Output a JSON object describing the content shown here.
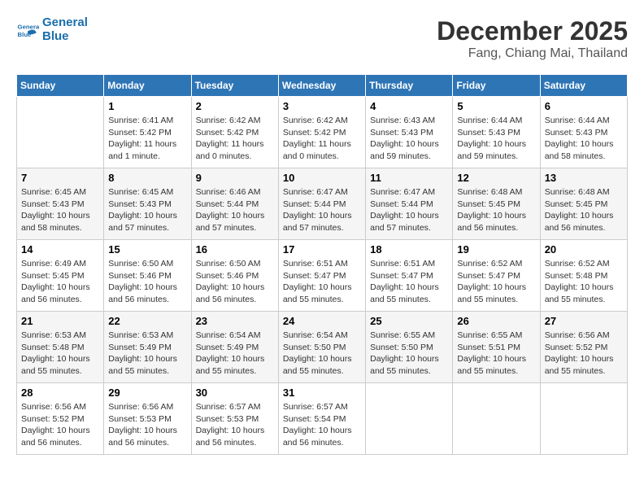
{
  "header": {
    "logo_line1": "General",
    "logo_line2": "Blue",
    "month": "December 2025",
    "location": "Fang, Chiang Mai, Thailand"
  },
  "weekdays": [
    "Sunday",
    "Monday",
    "Tuesday",
    "Wednesday",
    "Thursday",
    "Friday",
    "Saturday"
  ],
  "weeks": [
    [
      {
        "day": "",
        "sunrise": "",
        "sunset": "",
        "daylight": ""
      },
      {
        "day": "1",
        "sunrise": "Sunrise: 6:41 AM",
        "sunset": "Sunset: 5:42 PM",
        "daylight": "Daylight: 11 hours and 1 minute."
      },
      {
        "day": "2",
        "sunrise": "Sunrise: 6:42 AM",
        "sunset": "Sunset: 5:42 PM",
        "daylight": "Daylight: 11 hours and 0 minutes."
      },
      {
        "day": "3",
        "sunrise": "Sunrise: 6:42 AM",
        "sunset": "Sunset: 5:42 PM",
        "daylight": "Daylight: 11 hours and 0 minutes."
      },
      {
        "day": "4",
        "sunrise": "Sunrise: 6:43 AM",
        "sunset": "Sunset: 5:43 PM",
        "daylight": "Daylight: 10 hours and 59 minutes."
      },
      {
        "day": "5",
        "sunrise": "Sunrise: 6:44 AM",
        "sunset": "Sunset: 5:43 PM",
        "daylight": "Daylight: 10 hours and 59 minutes."
      },
      {
        "day": "6",
        "sunrise": "Sunrise: 6:44 AM",
        "sunset": "Sunset: 5:43 PM",
        "daylight": "Daylight: 10 hours and 58 minutes."
      }
    ],
    [
      {
        "day": "7",
        "sunrise": "Sunrise: 6:45 AM",
        "sunset": "Sunset: 5:43 PM",
        "daylight": "Daylight: 10 hours and 58 minutes."
      },
      {
        "day": "8",
        "sunrise": "Sunrise: 6:45 AM",
        "sunset": "Sunset: 5:43 PM",
        "daylight": "Daylight: 10 hours and 57 minutes."
      },
      {
        "day": "9",
        "sunrise": "Sunrise: 6:46 AM",
        "sunset": "Sunset: 5:44 PM",
        "daylight": "Daylight: 10 hours and 57 minutes."
      },
      {
        "day": "10",
        "sunrise": "Sunrise: 6:47 AM",
        "sunset": "Sunset: 5:44 PM",
        "daylight": "Daylight: 10 hours and 57 minutes."
      },
      {
        "day": "11",
        "sunrise": "Sunrise: 6:47 AM",
        "sunset": "Sunset: 5:44 PM",
        "daylight": "Daylight: 10 hours and 57 minutes."
      },
      {
        "day": "12",
        "sunrise": "Sunrise: 6:48 AM",
        "sunset": "Sunset: 5:45 PM",
        "daylight": "Daylight: 10 hours and 56 minutes."
      },
      {
        "day": "13",
        "sunrise": "Sunrise: 6:48 AM",
        "sunset": "Sunset: 5:45 PM",
        "daylight": "Daylight: 10 hours and 56 minutes."
      }
    ],
    [
      {
        "day": "14",
        "sunrise": "Sunrise: 6:49 AM",
        "sunset": "Sunset: 5:45 PM",
        "daylight": "Daylight: 10 hours and 56 minutes."
      },
      {
        "day": "15",
        "sunrise": "Sunrise: 6:50 AM",
        "sunset": "Sunset: 5:46 PM",
        "daylight": "Daylight: 10 hours and 56 minutes."
      },
      {
        "day": "16",
        "sunrise": "Sunrise: 6:50 AM",
        "sunset": "Sunset: 5:46 PM",
        "daylight": "Daylight: 10 hours and 56 minutes."
      },
      {
        "day": "17",
        "sunrise": "Sunrise: 6:51 AM",
        "sunset": "Sunset: 5:47 PM",
        "daylight": "Daylight: 10 hours and 55 minutes."
      },
      {
        "day": "18",
        "sunrise": "Sunrise: 6:51 AM",
        "sunset": "Sunset: 5:47 PM",
        "daylight": "Daylight: 10 hours and 55 minutes."
      },
      {
        "day": "19",
        "sunrise": "Sunrise: 6:52 AM",
        "sunset": "Sunset: 5:47 PM",
        "daylight": "Daylight: 10 hours and 55 minutes."
      },
      {
        "day": "20",
        "sunrise": "Sunrise: 6:52 AM",
        "sunset": "Sunset: 5:48 PM",
        "daylight": "Daylight: 10 hours and 55 minutes."
      }
    ],
    [
      {
        "day": "21",
        "sunrise": "Sunrise: 6:53 AM",
        "sunset": "Sunset: 5:48 PM",
        "daylight": "Daylight: 10 hours and 55 minutes."
      },
      {
        "day": "22",
        "sunrise": "Sunrise: 6:53 AM",
        "sunset": "Sunset: 5:49 PM",
        "daylight": "Daylight: 10 hours and 55 minutes."
      },
      {
        "day": "23",
        "sunrise": "Sunrise: 6:54 AM",
        "sunset": "Sunset: 5:49 PM",
        "daylight": "Daylight: 10 hours and 55 minutes."
      },
      {
        "day": "24",
        "sunrise": "Sunrise: 6:54 AM",
        "sunset": "Sunset: 5:50 PM",
        "daylight": "Daylight: 10 hours and 55 minutes."
      },
      {
        "day": "25",
        "sunrise": "Sunrise: 6:55 AM",
        "sunset": "Sunset: 5:50 PM",
        "daylight": "Daylight: 10 hours and 55 minutes."
      },
      {
        "day": "26",
        "sunrise": "Sunrise: 6:55 AM",
        "sunset": "Sunset: 5:51 PM",
        "daylight": "Daylight: 10 hours and 55 minutes."
      },
      {
        "day": "27",
        "sunrise": "Sunrise: 6:56 AM",
        "sunset": "Sunset: 5:52 PM",
        "daylight": "Daylight: 10 hours and 55 minutes."
      }
    ],
    [
      {
        "day": "28",
        "sunrise": "Sunrise: 6:56 AM",
        "sunset": "Sunset: 5:52 PM",
        "daylight": "Daylight: 10 hours and 56 minutes."
      },
      {
        "day": "29",
        "sunrise": "Sunrise: 6:56 AM",
        "sunset": "Sunset: 5:53 PM",
        "daylight": "Daylight: 10 hours and 56 minutes."
      },
      {
        "day": "30",
        "sunrise": "Sunrise: 6:57 AM",
        "sunset": "Sunset: 5:53 PM",
        "daylight": "Daylight: 10 hours and 56 minutes."
      },
      {
        "day": "31",
        "sunrise": "Sunrise: 6:57 AM",
        "sunset": "Sunset: 5:54 PM",
        "daylight": "Daylight: 10 hours and 56 minutes."
      },
      {
        "day": "",
        "sunrise": "",
        "sunset": "",
        "daylight": ""
      },
      {
        "day": "",
        "sunrise": "",
        "sunset": "",
        "daylight": ""
      },
      {
        "day": "",
        "sunrise": "",
        "sunset": "",
        "daylight": ""
      }
    ]
  ]
}
